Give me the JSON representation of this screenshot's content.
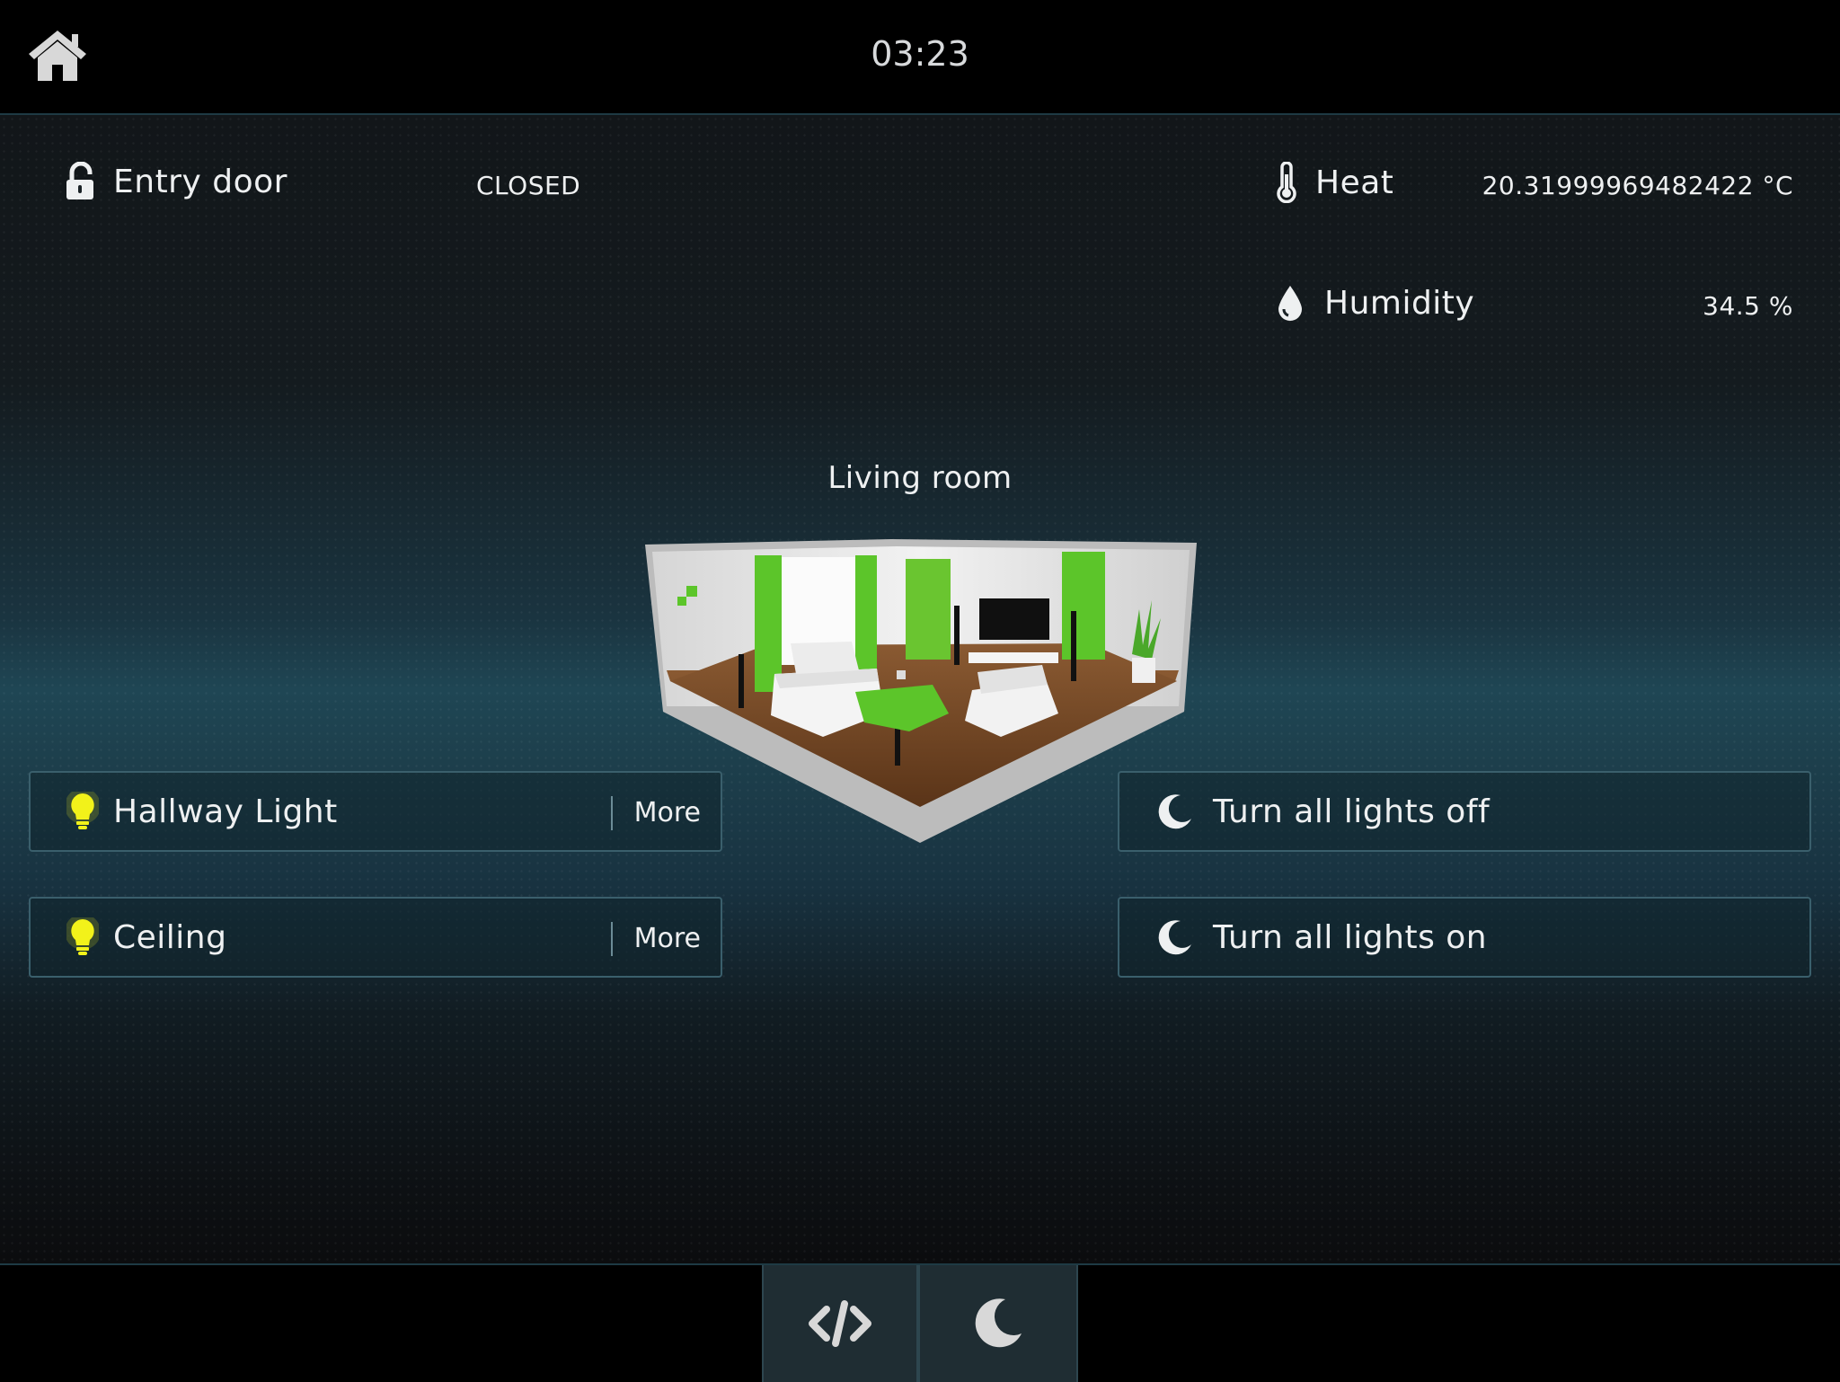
{
  "header": {
    "time": "03:23",
    "home_icon": "home-icon"
  },
  "status": {
    "entry_door": {
      "label": "Entry door",
      "value": "CLOSED",
      "icon": "unlock-icon"
    },
    "heat": {
      "label": "Heat",
      "value": "20.31999969482422 °C",
      "icon": "thermometer-icon"
    },
    "humidity": {
      "label": "Humidity",
      "value": "34.5 %",
      "icon": "droplet-icon"
    }
  },
  "room": {
    "title": "Living room"
  },
  "lights": [
    {
      "label": "Hallway Light",
      "more_label": "More",
      "icon": "lightbulb-icon",
      "color": "#f2f21a"
    },
    {
      "label": "Ceiling",
      "more_label": "More",
      "icon": "lightbulb-icon",
      "color": "#f2f21a"
    }
  ],
  "scenes": [
    {
      "label": "Turn all lights off",
      "icon": "moon-icon"
    },
    {
      "label": "Turn all lights on",
      "icon": "moon-icon"
    }
  ],
  "footer": {
    "tabs": [
      {
        "icon": "code-icon"
      },
      {
        "icon": "moon-icon"
      }
    ]
  }
}
